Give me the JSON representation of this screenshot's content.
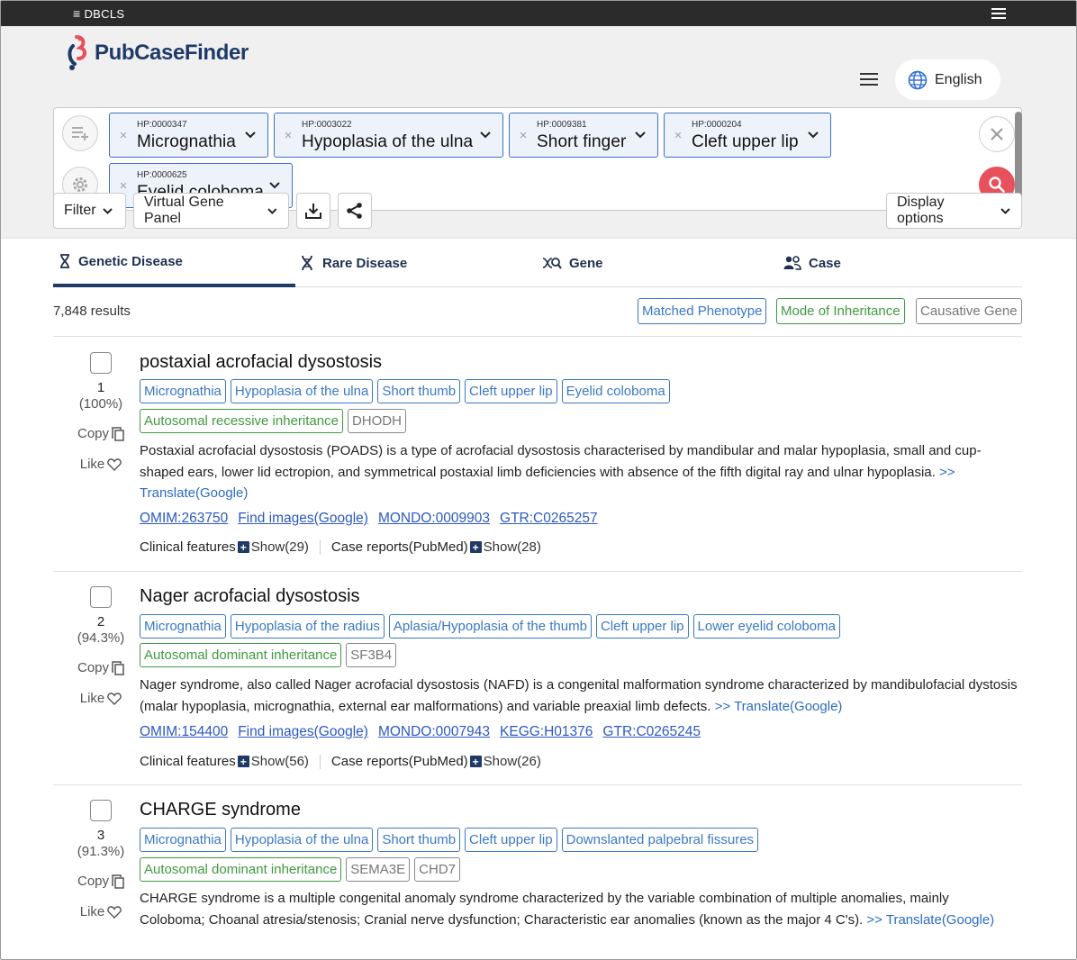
{
  "topbar": {
    "brand": "DBCLS",
    "menu_icon": "hamburger-icon"
  },
  "header": {
    "app_name": "PubCaseFinder",
    "language": "English",
    "colors": {
      "brand": "#1f3a68",
      "accent_red": "#e8505b",
      "chip_border": "#3b6fc8"
    }
  },
  "search": {
    "chips": [
      {
        "hp": "HP:0000347",
        "label": "Micrognathia"
      },
      {
        "hp": "HP:0003022",
        "label": "Hypoplasia of the ulna"
      },
      {
        "hp": "HP:0009381",
        "label": "Short finger"
      },
      {
        "hp": "HP:0000204",
        "label": "Cleft upper lip"
      },
      {
        "hp": "HP:0000625",
        "label": "Eyelid coloboma"
      }
    ]
  },
  "toolbar": {
    "filter": "Filter",
    "virtual_gene_panel": "Virtual Gene Panel",
    "display_options": "Display options"
  },
  "tabs": [
    {
      "label": "Genetic Disease",
      "icon": "dna-hourglass-icon",
      "active": true
    },
    {
      "label": "Rare Disease",
      "icon": "dna-helix-icon",
      "active": false
    },
    {
      "label": "Gene",
      "icon": "gene-search-icon",
      "active": false
    },
    {
      "label": "Case",
      "icon": "people-icon",
      "active": false
    }
  ],
  "results": {
    "count": "7,848 results",
    "legend": {
      "phenotype": "Matched Phenotype",
      "inheritance": "Mode of Inheritance",
      "gene": "Causative Gene"
    },
    "copy_label": "Copy",
    "like_label": "Like",
    "translate_label": "Translate(Google)",
    "more_marker": ">>",
    "clinical_features_label": "Clinical features",
    "case_reports_label": "Case reports(PubMed)",
    "items": [
      {
        "rank": "1",
        "score": "(100%)",
        "title": "postaxial acrofacial dysostosis",
        "phenotypes": [
          "Micrognathia",
          "Hypoplasia of the ulna",
          "Short thumb",
          "Cleft upper lip",
          "Eyelid coloboma"
        ],
        "inheritance": "Autosomal recessive inheritance",
        "genes": [
          "DHODH"
        ],
        "description": "Postaxial acrofacial dysostosis (POADS) is a type of acrofacial dysostosis characterised by mandibular and malar hypoplasia, small and cup-shaped ears, lower lid ectropion, and symmetrical postaxial limb deficiencies with absence of the fifth digital ray and ulnar hypoplasia.",
        "links": [
          "OMIM:263750",
          "Find images(Google)",
          "MONDO:0009903",
          "GTR:C0265257"
        ],
        "clinical_show": "Show(29)",
        "case_show": "Show(28)"
      },
      {
        "rank": "2",
        "score": "(94.3%)",
        "title": "Nager acrofacial dysostosis",
        "phenotypes": [
          "Micrognathia",
          "Hypoplasia of the radius",
          "Aplasia/Hypoplasia of the thumb",
          "Cleft upper lip",
          "Lower eyelid coloboma"
        ],
        "inheritance": "Autosomal dominant inheritance",
        "genes": [
          "SF3B4"
        ],
        "description": "Nager syndrome, also called Nager acrofacial dysostosis (NAFD) is a congenital malformation syndrome characterized by mandibulofacial dystosis (malar hypoplasia, micrognathia, external ear malformations) and variable preaxial limb defects.",
        "links": [
          "OMIM:154400",
          "Find images(Google)",
          "MONDO:0007943",
          "KEGG:H01376",
          "GTR:C0265245"
        ],
        "clinical_show": "Show(56)",
        "case_show": "Show(26)"
      },
      {
        "rank": "3",
        "score": "(91.3%)",
        "title": "CHARGE syndrome",
        "phenotypes": [
          "Micrognathia",
          "Hypoplasia of the ulna",
          "Short thumb",
          "Cleft upper lip",
          "Downslanted palpebral fissures"
        ],
        "inheritance": "Autosomal dominant inheritance",
        "genes": [
          "SEMA3E",
          "CHD7"
        ],
        "description": "CHARGE syndrome is a multiple congenital anomaly syndrome characterized by the variable combination of multiple anomalies, mainly Coloboma; Choanal atresia/stenosis; Cranial nerve dysfunction; Characteristic ear anomalies (known as the major 4 C's).",
        "links": [],
        "clinical_show": "",
        "case_show": ""
      }
    ]
  }
}
